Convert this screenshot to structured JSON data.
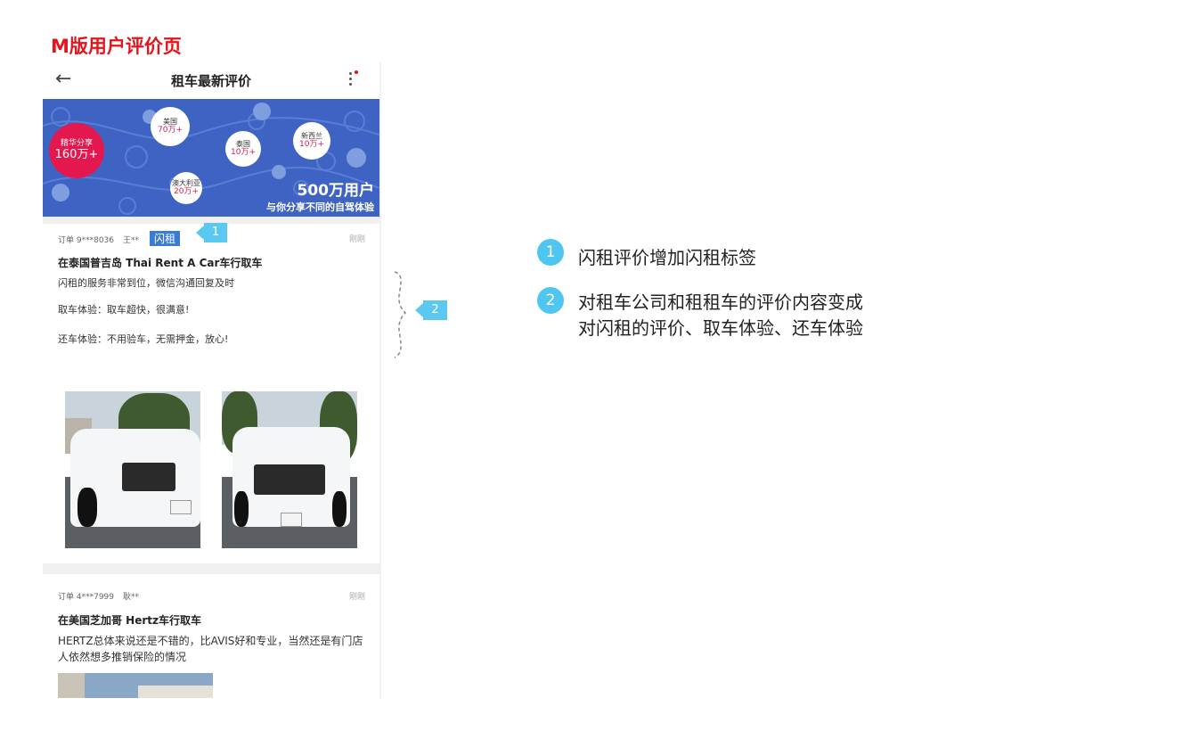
{
  "page_title": "M版用户评价页",
  "nav": {
    "back_icon": "arrow-left-icon",
    "title": "租车最新评价"
  },
  "banner": {
    "bubbles": [
      {
        "name": "精华分享",
        "value": "160万+"
      },
      {
        "name": "美国",
        "value": "70万+"
      },
      {
        "name": "泰国",
        "value": "10万+"
      },
      {
        "name": "新西兰",
        "value": "10万+"
      },
      {
        "name": "澳大利亚",
        "value": "20万+"
      }
    ],
    "headline": "500万用户",
    "subline": "与你分享不同的自驾体验"
  },
  "reviews": [
    {
      "order": "订单 9***8036",
      "user": "王**",
      "tag": "闪租",
      "time": "刚刚",
      "title": "在泰国普吉岛 Thai Rent A Car车行取车",
      "lines": [
        "闪租的服务非常到位，微信沟通回复及时",
        "取车体验：取车超快，很满意!",
        "还车体验：不用验车，无需押金，放心!"
      ]
    },
    {
      "order": "订单 4***7999",
      "user": "耿**",
      "time": "刚刚",
      "title": "在美国芝加哥 Hertz车行取车",
      "text": "HERTZ总体来说还是不错的，比AVIS好和专业，当然还是有门店人依然想多推销保险的情况"
    }
  ],
  "callouts": [
    "1",
    "2"
  ],
  "legend": [
    {
      "num": "1",
      "text": "闪租评价增加闪租标签"
    },
    {
      "num": "2",
      "text": "对租车公司和租租车的评价内容变成",
      "text2": "对闪租的评价、取车体验、还车体验"
    }
  ],
  "colors": {
    "title_red": "#e8131a",
    "banner_blue": "#3e63c3",
    "callout_blue": "#5bc8f2",
    "tag_blue": "#3a7bd5"
  }
}
